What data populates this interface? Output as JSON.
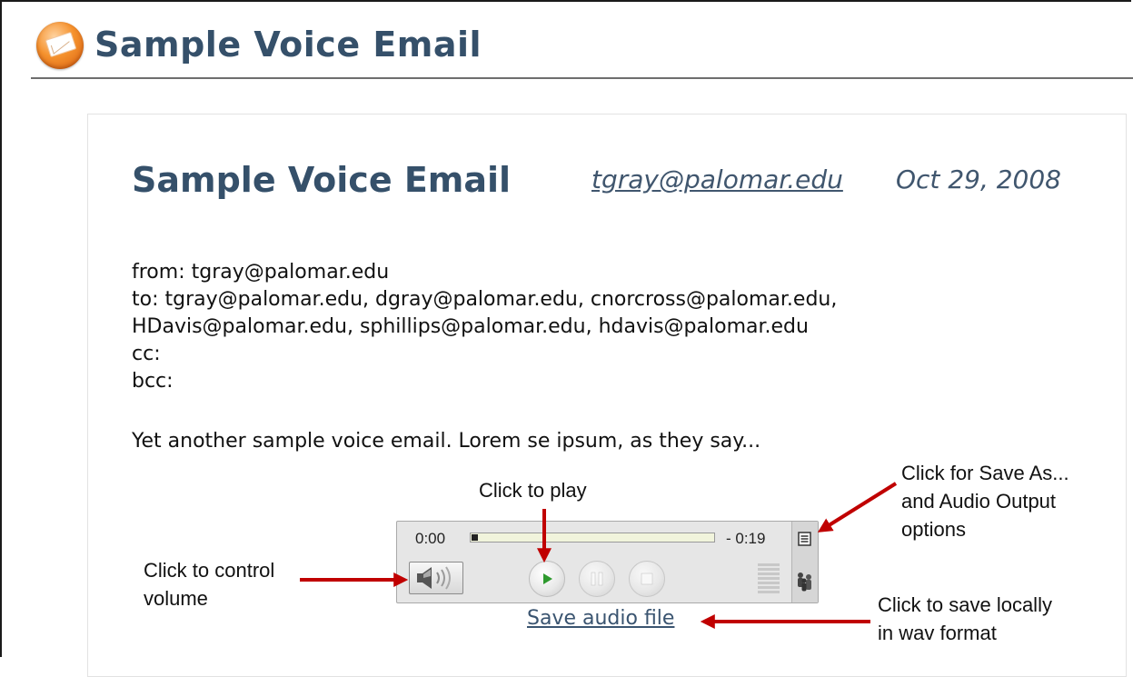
{
  "page": {
    "title": "Sample Voice Email"
  },
  "email": {
    "title": "Sample Voice Email",
    "from_link": "tgray@palomar.edu",
    "date": "Oct 29, 2008",
    "meta_lines": [
      "from: tgray@palomar.edu",
      "to: tgray@palomar.edu, dgray@palomar.edu, cnorcross@palomar.edu,",
      "HDavis@palomar.edu, sphillips@palomar.edu, hdavis@palomar.edu",
      "cc:",
      "bcc:"
    ],
    "body": "Yet another sample voice email. Lorem se ipsum, as they say..."
  },
  "player": {
    "time_elapsed": "0:00",
    "time_remaining": "- 0:19",
    "progress_fraction": 0,
    "save_link": "Save audio file"
  },
  "annotations": {
    "play": "Click to play",
    "save_as": [
      "Click for Save As...",
      "and Audio Output",
      "options"
    ],
    "volume": [
      "Click to control",
      "volume"
    ],
    "save_locally": [
      "Click to save locally",
      "in wav format"
    ]
  },
  "colors": {
    "heading": "#35506a",
    "arrow": "#c00000",
    "play_triangle": "#2e9a2e",
    "header_icon": "#f5922e"
  },
  "icons": [
    "envelope-badge-icon",
    "speaker-icon",
    "play-icon",
    "pause-icon",
    "stop-icon",
    "menu-icon",
    "people-icon"
  ]
}
